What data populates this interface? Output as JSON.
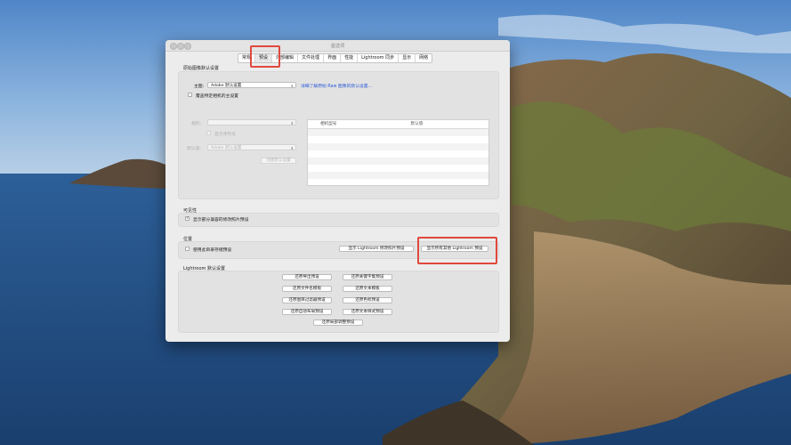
{
  "window": {
    "title": "首选项"
  },
  "tabs": [
    {
      "label": "常规",
      "active": false
    },
    {
      "label": "预设",
      "active": true
    },
    {
      "label": "外部编辑",
      "active": false
    },
    {
      "label": "文件处理",
      "active": false
    },
    {
      "label": "界面",
      "active": false
    },
    {
      "label": "性能",
      "active": false
    },
    {
      "label": "Lightroom 同步",
      "active": false
    },
    {
      "label": "显示",
      "active": false
    },
    {
      "label": "网络",
      "active": false
    }
  ],
  "raw_defaults": {
    "section_label": "原始图像默认设置",
    "master_label": "主图:",
    "master_value": "Adobe 默认设置",
    "learn_more_link": "详细了解原始 Raw 图像的默认设置...",
    "override_checkbox_label": "覆盖特定相机的主设置",
    "camera_label": "相机:",
    "camera_value": "",
    "show_serial_label": "显示序列号",
    "default_label": "默认值:",
    "default_value": "Adobe 默认设置",
    "create_default_button": "创建默认设置",
    "table_headers": [
      "相机型号",
      "默认值"
    ]
  },
  "visibility": {
    "section_label": "可见性",
    "checkbox_label": "显示部分兼容的修改照片预设",
    "checked": true
  },
  "location": {
    "section_label": "位置",
    "checkbox_label": "使用此目录存储预设",
    "checked": false,
    "show_develop_presets_button": "显示 Lightroom 修改照片预设",
    "show_all_presets_button": "显示所有其他 Lightroom 预设"
  },
  "lightroom_defaults": {
    "section_label": "Lightroom 默认设置",
    "buttons_left": [
      "还原导出预设",
      "还原文件名模板",
      "还原图库过滤器预设",
      "还原自动布局预设"
    ],
    "buttons_right": [
      "还原关键字集预设",
      "还原文本模板",
      "还原色标预设",
      "还原文本样式预设"
    ],
    "bottom_button": "还原局部调整预设"
  },
  "colors": {
    "highlight": "#e0483d",
    "link": "#2a5bd7",
    "sky_top": "#5b8fcf",
    "sea": "#1f4f86"
  }
}
